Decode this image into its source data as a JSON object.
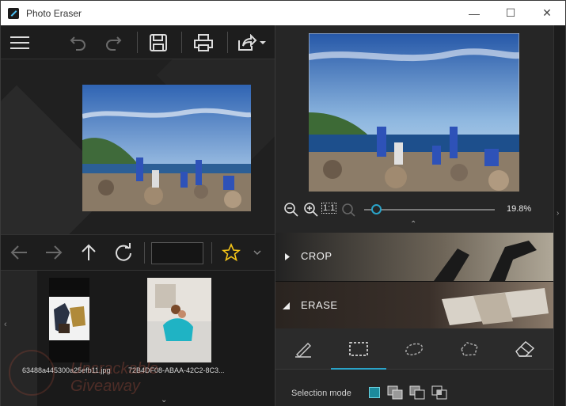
{
  "window": {
    "title": "Photo Eraser",
    "controls": {
      "minimize": "—",
      "maximize": "☐",
      "close": "✕"
    }
  },
  "toolbar": {
    "icons": [
      "menu-icon",
      "undo-icon",
      "redo-icon",
      "save-icon",
      "print-icon",
      "share-icon"
    ]
  },
  "navigation": {
    "icons": [
      "back-arrow-icon",
      "forward-arrow-icon",
      "up-arrow-icon",
      "refresh-icon",
      "star-icon",
      "chevron-down-icon"
    ],
    "path_value": ""
  },
  "thumbnails": [
    {
      "name": "63488a445300a25efb11.jpg"
    },
    {
      "name": "72B4DF08-ABAA-42C2-8C3..."
    }
  ],
  "zoom": {
    "level_text": "19.8%",
    "level_fraction": 0.198,
    "icons": [
      "zoom-out-icon",
      "zoom-in-icon",
      "actual-size-icon",
      "fit-icon"
    ],
    "actual_size_label": "1:1"
  },
  "panels": {
    "crop": {
      "label": "CROP",
      "expanded": false
    },
    "erase": {
      "label": "ERASE",
      "expanded": true
    }
  },
  "tools": [
    "brush-icon",
    "rect-select-icon",
    "lasso-icon",
    "polygon-lasso-icon",
    "eraser-icon"
  ],
  "selection_mode": {
    "label": "Selection mode",
    "icons": [
      "new-selection-icon",
      "add-selection-icon",
      "subtract-selection-icon",
      "intersect-selection-icon"
    ]
  },
  "watermark": {
    "line1": "Uncrackable",
    "line2": "Giveaway"
  },
  "colors": {
    "accent": "#2aa3c8",
    "star": "#f5c518",
    "sky": "#3b6fb6",
    "sea": "#1d4f8c"
  }
}
